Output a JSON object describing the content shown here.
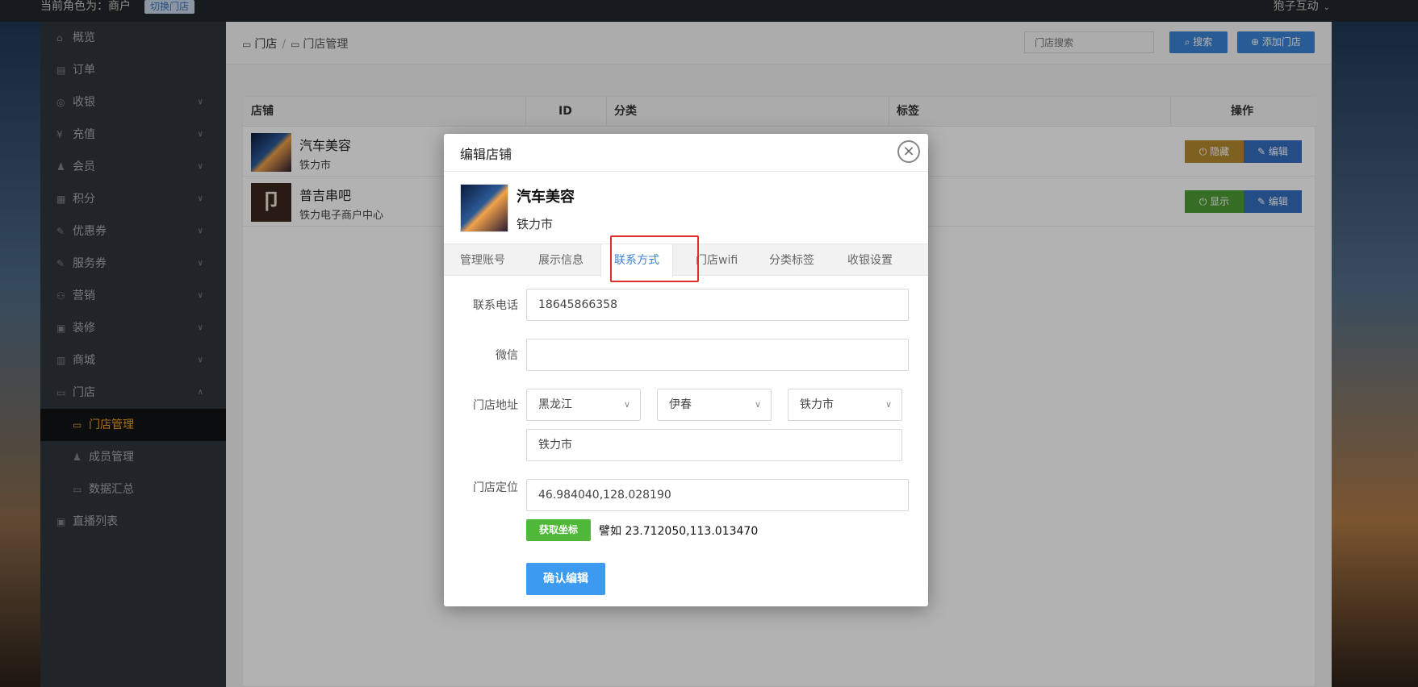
{
  "topbar": {
    "role_text": "当前角色为：商户",
    "switch_label": "切换门店",
    "user_name": "狍子互动"
  },
  "sidebar": {
    "items": [
      {
        "label": "概览",
        "icon": "home-icon",
        "has_arrow": false
      },
      {
        "label": "订单",
        "icon": "order-icon",
        "has_arrow": false
      },
      {
        "label": "收银",
        "icon": "cashier-icon",
        "has_arrow": true
      },
      {
        "label": "充值",
        "icon": "recharge-icon",
        "has_arrow": true
      },
      {
        "label": "会员",
        "icon": "member-icon",
        "has_arrow": true
      },
      {
        "label": "积分",
        "icon": "points-icon",
        "has_arrow": true
      },
      {
        "label": "优惠券",
        "icon": "coupon-icon",
        "has_arrow": true
      },
      {
        "label": "服务券",
        "icon": "service-coupon-icon",
        "has_arrow": true
      },
      {
        "label": "营销",
        "icon": "marketing-icon",
        "has_arrow": true
      },
      {
        "label": "装修",
        "icon": "decoration-icon",
        "has_arrow": true
      },
      {
        "label": "商城",
        "icon": "mall-icon",
        "has_arrow": true
      },
      {
        "label": "门店",
        "icon": "store-icon",
        "has_arrow": true
      },
      {
        "label": "门店管理",
        "icon": "store-manage-icon",
        "sub": true,
        "active": true
      },
      {
        "label": "成员管理",
        "icon": "members-icon",
        "sub": true
      },
      {
        "label": "数据汇总",
        "icon": "data-icon",
        "sub": true
      },
      {
        "label": "直播列表",
        "icon": "live-icon",
        "has_arrow": false
      }
    ]
  },
  "header": {
    "breadcrumb_root": "门店",
    "breadcrumb_sep": "/",
    "breadcrumb_current": "门店管理",
    "search_placeholder": "门店搜索",
    "search_button": "搜索",
    "add_button": "添加门店"
  },
  "table": {
    "columns": [
      "店铺",
      "ID",
      "分类",
      "标签",
      "操作"
    ],
    "rows": [
      {
        "name": "汽车美容",
        "addr": "铁力市",
        "toggle_label": "隐藏",
        "edit_label": "编辑"
      },
      {
        "name": "普吉串吧",
        "addr": "铁力电子商户中心",
        "toggle_label": "显示",
        "edit_label": "编辑"
      }
    ]
  },
  "modal": {
    "title": "编辑店铺",
    "close_icon": "×",
    "store_name": "汽车美容",
    "store_city": "铁力市",
    "tabs": [
      "管理账号",
      "展示信息",
      "联系方式",
      "门店wifi",
      "分类标签",
      "收银设置"
    ],
    "active_tab": "联系方式",
    "form": {
      "phone_label": "联系电话",
      "phone_value": "18645866358",
      "wechat_label": "微信",
      "wechat_value": "",
      "address_label": "门店地址",
      "province": "黑龙江",
      "city": "伊春",
      "district": "铁力市",
      "address_detail": "铁力市",
      "location_label": "门店定位",
      "location_value": "46.984040,128.028190",
      "get_coord_button": "获取坐标",
      "coord_example": "譬如 23.712050,113.013470",
      "confirm_button": "确认编辑"
    }
  },
  "colors": {
    "accent": "#3c84d6",
    "sidebar_bg": "#2f353b",
    "active_nav": "#f5a623",
    "highlight": "#e02b2b",
    "green": "#4fb838"
  }
}
